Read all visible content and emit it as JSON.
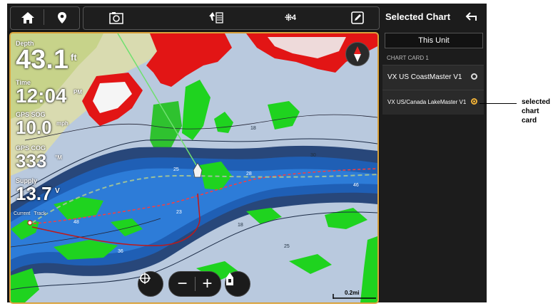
{
  "topbar": {
    "home_icon": "home-icon",
    "waypoint_icon": "waypoint-pin-icon",
    "chart_icon": "chart-settings-icon",
    "sonar_icon": "sonar-icon",
    "satellites_icon": "gps-satellites-icon",
    "satellite_count": "4",
    "edit_icon": "edit-icon"
  },
  "panel": {
    "title": "Selected Chart",
    "back_icon": "back-arrow-icon",
    "this_unit": "This Unit",
    "section_label": "CHART CARD 1",
    "items": [
      {
        "label": "VX US CoastMaster V1",
        "selected": false
      },
      {
        "label": "VX US/Canada LakeMaster V1",
        "selected": true
      }
    ]
  },
  "readouts": {
    "depth": {
      "label": "Depth",
      "value": "43.1",
      "unit": "ft"
    },
    "time": {
      "label": "Time",
      "value": "12:04",
      "unit": "PM"
    },
    "sog": {
      "label": "GPS SOG",
      "value": "10.0",
      "unit": "mph"
    },
    "cog": {
      "label": "GPS COG",
      "value": "333",
      "unit": "°M"
    },
    "supply": {
      "label": "Supply",
      "value": "13.7",
      "unit": "V"
    }
  },
  "map": {
    "track_label_current": "Current",
    "track_label_track": "Track",
    "scale": "0.2mi",
    "depth_marks": [
      "18",
      "25",
      "28",
      "46",
      "48",
      "36",
      "23",
      "18",
      "25",
      "30"
    ]
  },
  "controls": {
    "target_icon": "crosshair-icon",
    "zoom_out": "−",
    "zoom_in": "+",
    "boat_icon": "boat-position-icon",
    "compass_icon": "north-compass-icon"
  },
  "callout": {
    "line1": "selected",
    "line2": "chart",
    "line3": "card"
  },
  "colors": {
    "accent": "#f0b23a",
    "panel_bg": "#1c1c1c",
    "land_shallow": "#1fd31f",
    "danger_red": "#e01010",
    "channel_blue": "#1f5fb5",
    "deep_water": "#28477a"
  }
}
